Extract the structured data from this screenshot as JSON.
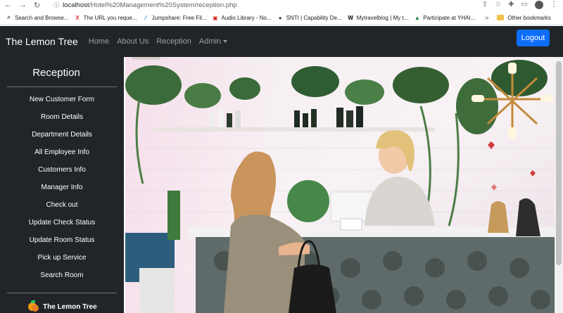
{
  "browser": {
    "url_host": "localhost",
    "url_path": "/Hotel%20Management%20System/reception.php",
    "bookmarks": [
      {
        "label": "Search and Browse...",
        "icon": "search-icon",
        "color": "#4a4a4a"
      },
      {
        "label": "The URL you reque...",
        "icon": "x-icon",
        "color": "#d93025"
      },
      {
        "label": "Jumpshare: Free Fil...",
        "icon": "jumpshare-icon",
        "color": "#1a73e8"
      },
      {
        "label": "Audio Library - No...",
        "icon": "audio-library-icon",
        "color": "#d93025"
      },
      {
        "label": "SNTI | Capability De...",
        "icon": "globe-icon",
        "color": "#444444"
      },
      {
        "label": "Mytravelblog | My t...",
        "icon": "wix-icon",
        "color": "#000000"
      },
      {
        "label": "Participate at YHAI...",
        "icon": "triangle-icon",
        "color": "#188038"
      }
    ],
    "more": "»",
    "other_bookmarks": "Other bookmarks"
  },
  "navbar": {
    "brand": "The Lemon Tree",
    "links": [
      "Home",
      "About Us",
      "Reception"
    ],
    "admin": "Admin",
    "logout": "Logout",
    "accent": "#0d6efd"
  },
  "sidebar": {
    "title": "Reception",
    "items": [
      "New Customer Form",
      "Room Details",
      "Department Details",
      "All Employee Info",
      "Customers Info",
      "Manager Info",
      "Check out",
      "Update Check Status",
      "Update Room Status",
      "Pick up Service",
      "Search Room"
    ],
    "footer": "The Lemon Tree"
  },
  "hero": {
    "image": "reception-desk-photo"
  }
}
